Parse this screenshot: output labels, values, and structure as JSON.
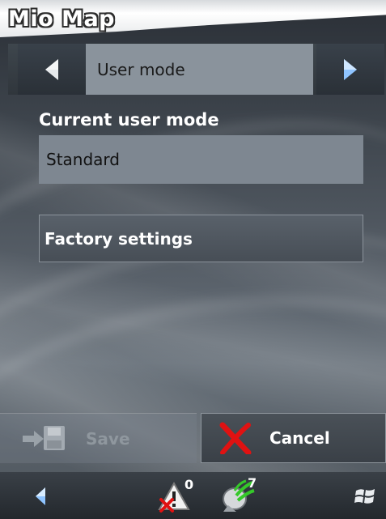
{
  "app": {
    "title": "Mio Map"
  },
  "nav": {
    "mode_label": "User mode",
    "prev_icon": "arrow-left-icon",
    "next_icon": "arrow-right-icon"
  },
  "current_mode": {
    "label": "Current user mode",
    "value": "Standard"
  },
  "factory": {
    "label": "Factory settings"
  },
  "actions": {
    "save_label": "Save",
    "cancel_label": "Cancel"
  },
  "taskbar": {
    "back_icon": "back-arrow-icon",
    "warnings_count": "0",
    "satellites_count": "7",
    "start_icon": "windows-flag-icon"
  },
  "colors": {
    "accent_blue": "#8fc4ff",
    "cancel_red": "#e01212",
    "satellite_green": "#35c82a"
  }
}
